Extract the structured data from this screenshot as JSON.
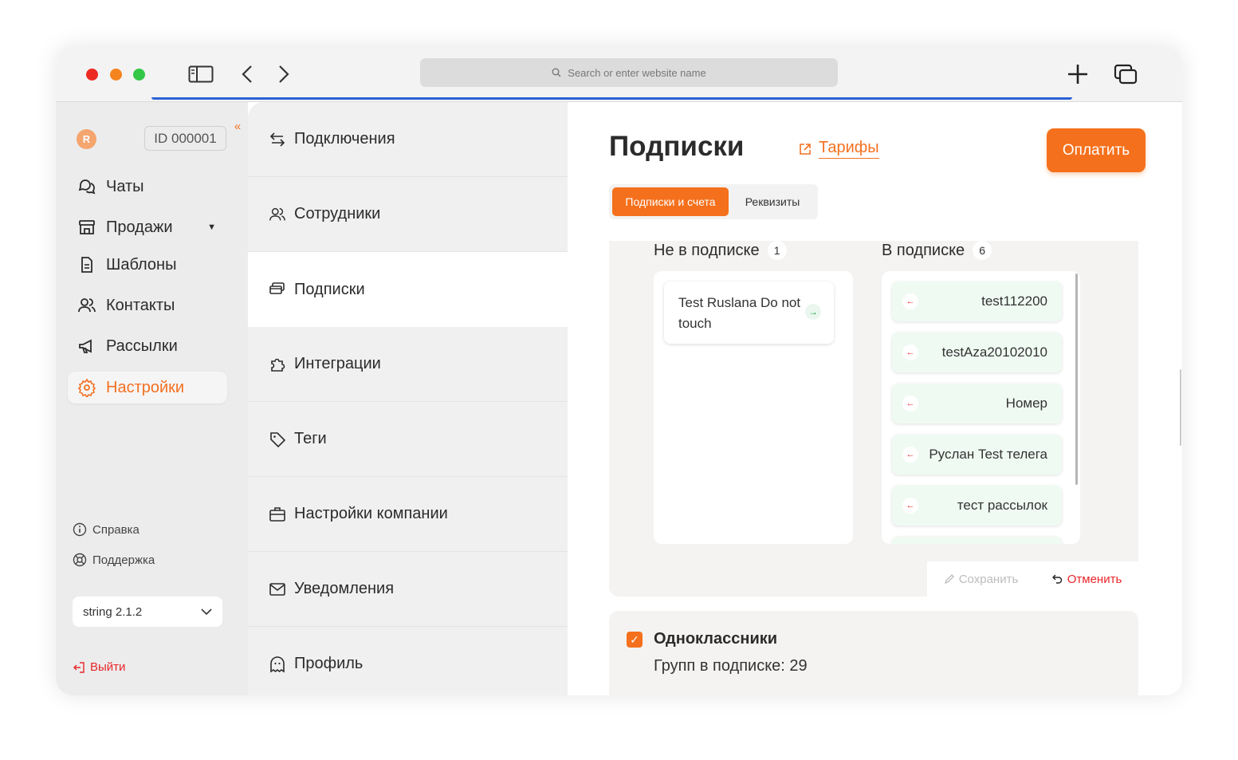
{
  "browser": {
    "address_placeholder": "Search or enter website name"
  },
  "sidebar": {
    "account_id": "ID 000001",
    "items": [
      {
        "label": "Чаты",
        "icon": "chats-icon"
      },
      {
        "label": "Продажи",
        "icon": "store-icon",
        "has_caret": true
      },
      {
        "label": "Шаблоны",
        "icon": "document-icon"
      },
      {
        "label": "Контакты",
        "icon": "users-icon"
      },
      {
        "label": "Рассылки",
        "icon": "megaphone-icon"
      },
      {
        "label": "Настройки",
        "icon": "gear-icon",
        "active": true
      }
    ],
    "help_label": "Справка",
    "support_label": "Поддержка",
    "version": "string 2.1.2",
    "logout_label": "Выйти"
  },
  "settings_menu": {
    "items": [
      {
        "label": "Подключения",
        "icon": "arrows-swap-icon"
      },
      {
        "label": "Сотрудники",
        "icon": "users-icon"
      },
      {
        "label": "Подписки",
        "icon": "cards-icon",
        "active": true
      },
      {
        "label": "Интеграции",
        "icon": "puzzle-icon"
      },
      {
        "label": "Теги",
        "icon": "tag-icon"
      },
      {
        "label": "Настройки компании",
        "icon": "briefcase-icon"
      },
      {
        "label": "Уведомления",
        "icon": "mail-icon"
      },
      {
        "label": "Профиль",
        "icon": "ghost-icon"
      }
    ]
  },
  "main": {
    "title": "Подписки",
    "tariffs_link": "Тарифы",
    "pay_button": "Оплатить",
    "tabs": [
      {
        "label": "Подписки и счета",
        "active": true
      },
      {
        "label": "Реквизиты",
        "active": false
      }
    ],
    "not_subscribed": {
      "title": "Не в подписке",
      "count": "1",
      "items": [
        "Test Ruslana Do not touch"
      ]
    },
    "subscribed": {
      "title": "В подписке",
      "count": "6",
      "items": [
        "test112200",
        "testAza20102010",
        "Номер",
        "Руслан Test телега",
        "тест рассылок"
      ]
    },
    "save_label": "Сохранить",
    "cancel_label": "Отменить",
    "odnoklassniki": {
      "title": "Одноклассники",
      "groups_text": "Групп в подписке: 29",
      "checked": true
    }
  },
  "colors": {
    "accent": "#f5701c",
    "danger": "#e8262a",
    "success": "#27a04a"
  }
}
